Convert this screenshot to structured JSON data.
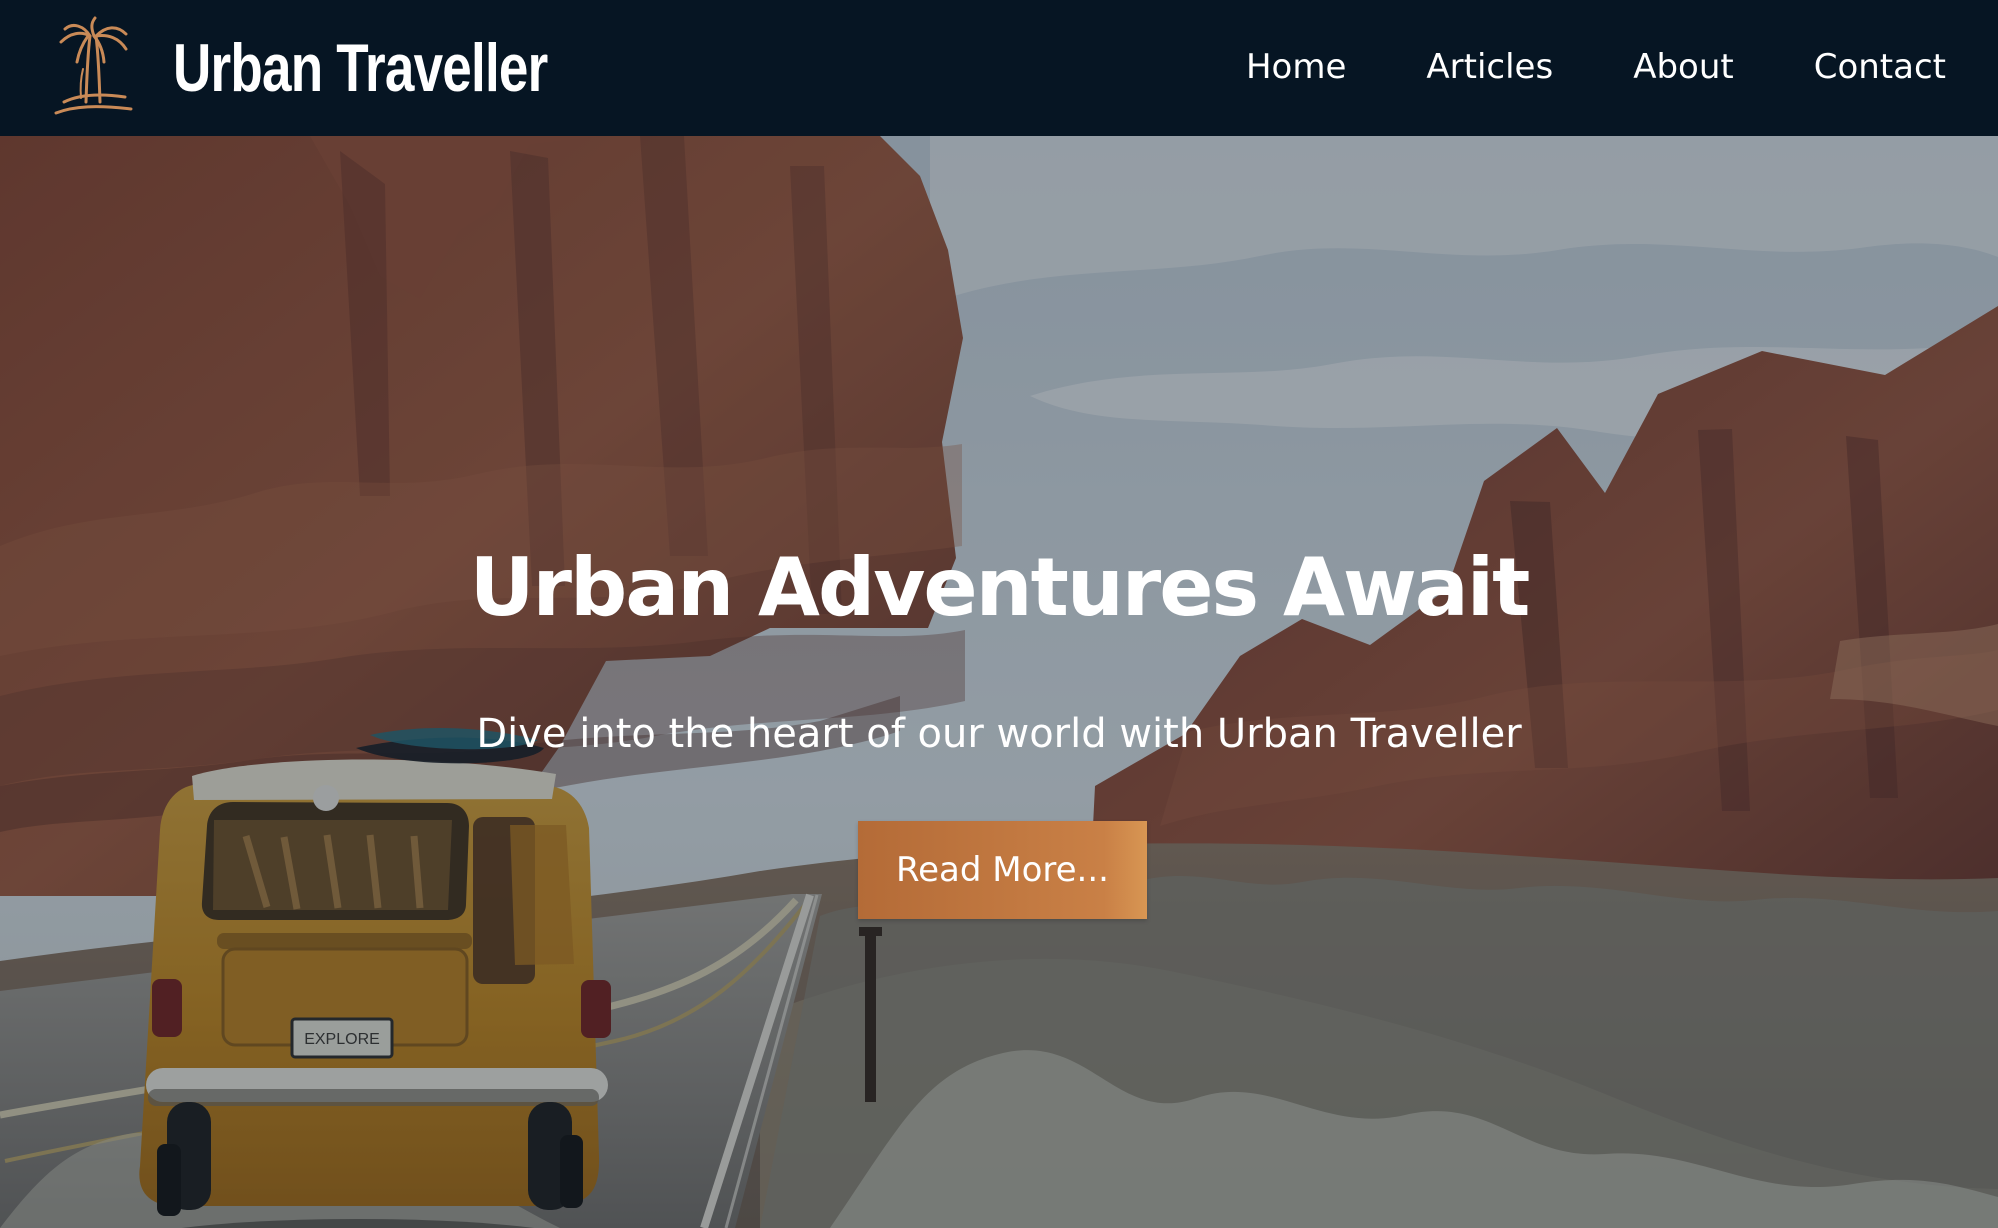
{
  "brand": {
    "name": "Urban Traveller",
    "logo_icon": "palm-tree-icon",
    "accent_color": "#c98a57"
  },
  "nav": {
    "items": [
      {
        "label": "Home"
      },
      {
        "label": "Articles"
      },
      {
        "label": "About"
      },
      {
        "label": "Contact"
      }
    ]
  },
  "hero": {
    "title": "Urban Adventures Await",
    "subtitle": "Dive into the heart of our world with Urban Traveller",
    "button_label": "Read More...",
    "image": {
      "scene": "desert-road-canyon-van",
      "license_plate_text": "EXPLORE"
    }
  },
  "colors": {
    "header_background": "#061523",
    "button_background": "#c07a43",
    "text": "#ffffff"
  }
}
